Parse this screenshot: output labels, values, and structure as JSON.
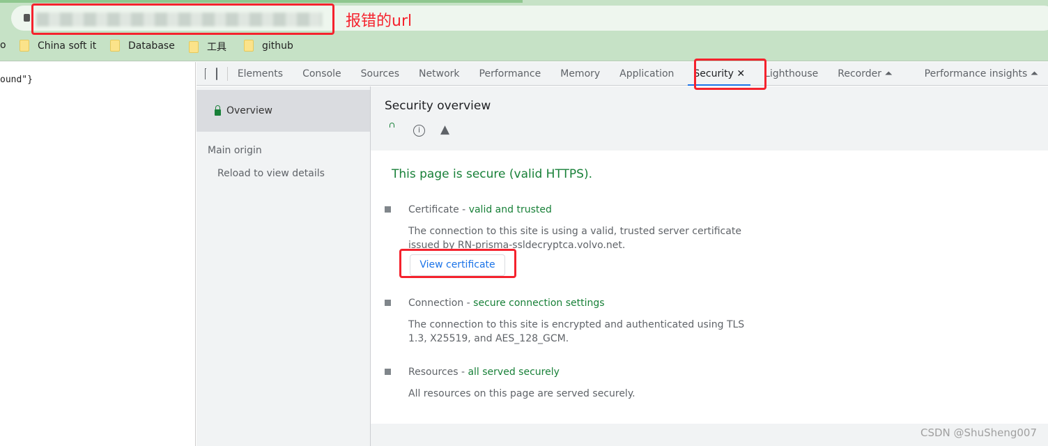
{
  "browser": {
    "bookmarks": [
      {
        "label": "China soft it"
      },
      {
        "label": "Database"
      },
      {
        "label": "工具"
      },
      {
        "label": "github"
      }
    ],
    "partial_bookmark": "o"
  },
  "page": {
    "text": "ound\"}"
  },
  "devtools": {
    "tabs": [
      "Elements",
      "Console",
      "Sources",
      "Network",
      "Performance",
      "Memory",
      "Application",
      "Security",
      "Lighthouse",
      "Recorder",
      "Performance insights"
    ],
    "active_tab": "Security"
  },
  "sidebar": {
    "overview": "Overview",
    "main_origin": "Main origin",
    "reload": "Reload to view details"
  },
  "main": {
    "title": "Security overview",
    "summary": "This page is secure (valid HTTPS).",
    "certificate": {
      "title": "Certificate",
      "status": "valid and trusted",
      "desc": "The connection to this site is using a valid, trusted server certificate issued by RN-prisma-ssldecryptca.volvo.net.",
      "button": "View certificate"
    },
    "connection": {
      "title": "Connection",
      "status": "secure connection settings",
      "desc": "The connection to this site is encrypted and authenticated using TLS 1.3, X25519, and AES_128_GCM."
    },
    "resources": {
      "title": "Resources",
      "status": "all served securely",
      "desc": "All resources on this page are served securely."
    }
  },
  "annotation": {
    "label": "报错的url",
    "color": "#f5222d"
  },
  "watermark": "CSDN @ShuSheng007",
  "colors": {
    "secure_green": "#188038",
    "accent": "#1a73e8"
  }
}
